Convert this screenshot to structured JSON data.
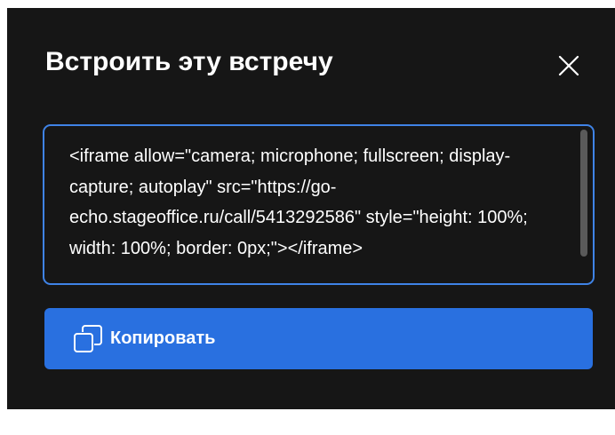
{
  "dialog": {
    "title": "Встроить эту встречу",
    "close_icon": "close-icon",
    "embed_code": "<iframe allow=\"camera; microphone; fullscreen; display-capture; autoplay\" src=\"https://go-echo.stageoffice.ru/call/5413292586\" style=\"height: 100%; width: 100%; border: 0px;\"></iframe>",
    "copy_button": {
      "label": "Копировать",
      "icon": "copy-icon"
    }
  },
  "colors": {
    "dialog_background": "#161616",
    "accent": "#2970e0",
    "focus_border": "#3f83e6",
    "text": "#ffffff"
  }
}
